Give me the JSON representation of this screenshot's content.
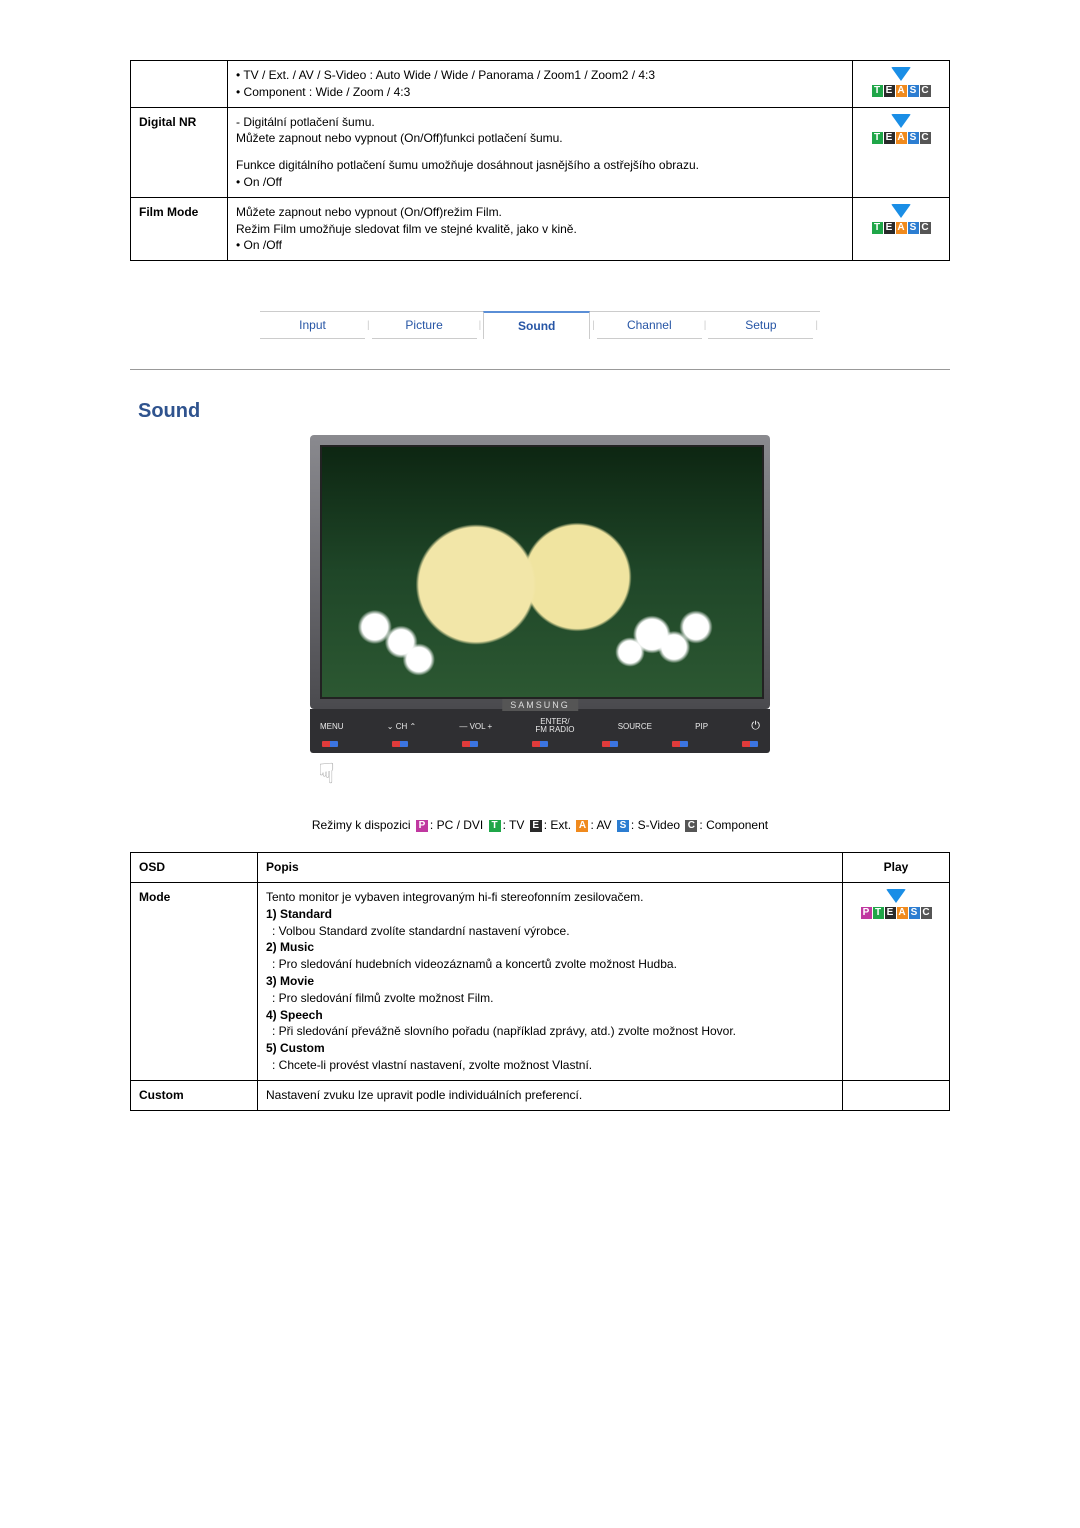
{
  "table1": {
    "rows": [
      {
        "name": "",
        "desc_lines": [
          "• TV / Ext. / AV / S-Video : Auto Wide / Wide / Panorama / Zoom1 / Zoom2 / 4:3",
          "• Component : Wide / Zoom / 4:3"
        ],
        "play_badges": [
          "T",
          "E",
          "A",
          "S",
          "C"
        ]
      },
      {
        "name": "Digital NR",
        "desc_lines": [
          "- Digitální potlačení šumu.",
          "Můžete zapnout nebo vypnout (On/Off)funkci potlačení šumu.",
          "",
          "Funkce digitálního potlačení šumu umožňuje dosáhnout jasnějšího a ostřejšího obrazu.",
          "• On /Off"
        ],
        "play_badges": [
          "T",
          "E",
          "A",
          "S",
          "C"
        ]
      },
      {
        "name": "Film Mode",
        "desc_lines": [
          "Můžete zapnout nebo vypnout (On/Off)režim Film.",
          "Režim Film umožňuje sledovat film ve stejné kvalitě, jako v kině.",
          "• On /Off"
        ],
        "play_badges": [
          "T",
          "E",
          "A",
          "S",
          "C"
        ]
      }
    ]
  },
  "nav": {
    "tabs": [
      "Input",
      "Picture",
      "Sound",
      "Channel",
      "Setup"
    ],
    "active": "Sound"
  },
  "section_title": "Sound",
  "tv": {
    "brand": "SAMSUNG",
    "controls": [
      "MENU",
      "⌄  CH  ⌃",
      "—  VOL  +",
      "ENTER/\nFM RADIO",
      "SOURCE",
      "PIP"
    ],
    "power": "⏻"
  },
  "modes": {
    "intro": "Režimy k dispozici",
    "items": [
      {
        "badge": "P",
        "class": "bP",
        "label": ": PC / DVI"
      },
      {
        "badge": "T",
        "class": "bT",
        "label": ": TV"
      },
      {
        "badge": "E",
        "class": "bE",
        "label": ": Ext."
      },
      {
        "badge": "A",
        "class": "bA",
        "label": ": AV"
      },
      {
        "badge": "S",
        "class": "bS",
        "label": ": S-Video"
      },
      {
        "badge": "C",
        "class": "bC",
        "label": ": Component"
      }
    ]
  },
  "table2": {
    "headers": {
      "osd": "OSD",
      "desc": "Popis",
      "play": "Play"
    },
    "rows": [
      {
        "name": "Mode",
        "intro": "Tento monitor je vybaven integrovaným hi-fi stereofonním zesilovačem.",
        "items": [
          {
            "t": "1) Standard",
            "d": ": Volbou Standard zvolíte standardní nastavení výrobce."
          },
          {
            "t": "2) Music",
            "d": ": Pro sledování hudebních videozáznamů a koncertů zvolte možnost Hudba."
          },
          {
            "t": "3) Movie",
            "d": ": Pro sledování filmů zvolte možnost Film."
          },
          {
            "t": "4) Speech",
            "d": ": Při sledování převážně slovního pořadu (například zprávy, atd.) zvolte možnost Hovor."
          },
          {
            "t": "5) Custom",
            "d": ": Chcete-li provést vlastní nastavení, zvolte možnost Vlastní."
          }
        ],
        "play_badges": [
          "P",
          "T",
          "E",
          "A",
          "S",
          "C"
        ]
      },
      {
        "name": "Custom",
        "intro": "Nastavení zvuku lze upravit podle individuálních preferencí.",
        "items": [],
        "play_badges": []
      }
    ]
  }
}
